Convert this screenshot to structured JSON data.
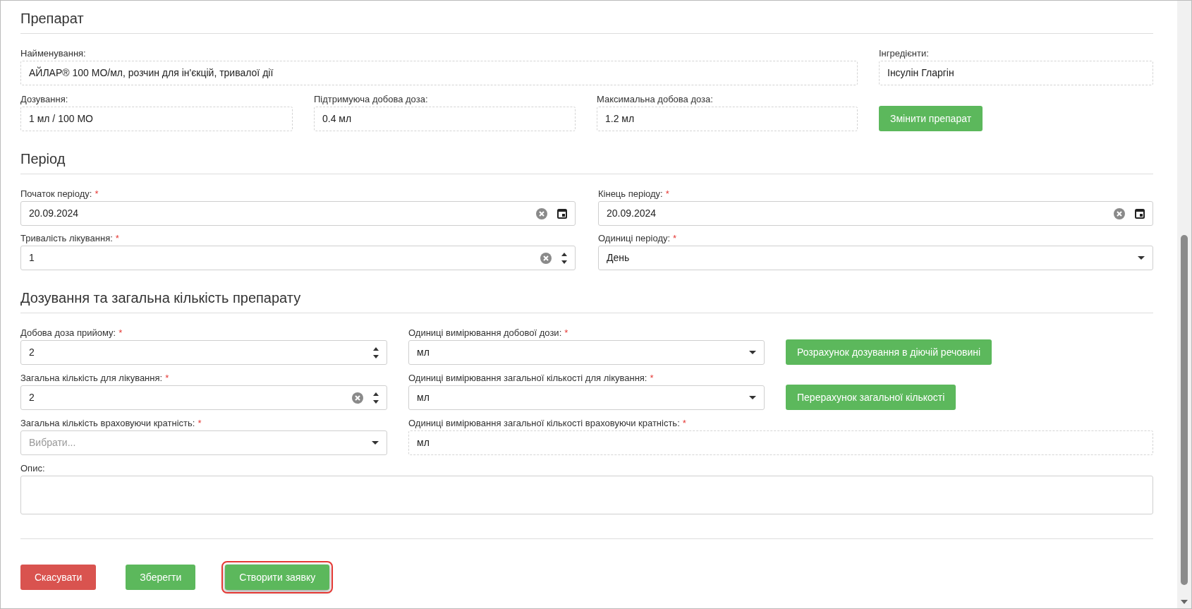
{
  "sections": [
    {
      "title": "Препарат",
      "fields": [
        {
          "label": "Найменування:",
          "kind": "readonly",
          "value": "АЙЛАР® 100 МО/мл, розчин для ін'єкцій, тривалої дії"
        },
        {
          "label": "Інгредієнти:",
          "kind": "readonly",
          "value": "Інсулін Гларгін"
        },
        {
          "label": "Дозування:",
          "kind": "readonly",
          "value": "1 мл / 100 МО"
        },
        {
          "label": "Підтримуюча добова доза:",
          "kind": "readonly",
          "value": "0.4 мл"
        },
        {
          "label": "Максимальна добова доза:",
          "kind": "readonly",
          "value": "1.2 мл"
        },
        {
          "kind": "button",
          "label": "Змінити препарат"
        }
      ]
    },
    {
      "title": "Період",
      "fields": [
        {
          "label": "Початок періоду:",
          "required_mark": "*",
          "kind": "date",
          "value": "20.09.2024",
          "clearable": true
        },
        {
          "label": "Кінець періоду:",
          "required_mark": "*",
          "kind": "date",
          "value": "20.09.2024",
          "clearable": true
        },
        {
          "label": "Тривалість лікування:",
          "required_mark": "*",
          "kind": "number",
          "value": "1",
          "clearable": true
        },
        {
          "label": "Одиниці періоду:",
          "required_mark": "*",
          "kind": "select",
          "value": "День"
        }
      ]
    },
    {
      "title": "Дозування та загальна кількість препарату",
      "fields": [
        {
          "label": "Добова доза прийому:",
          "required_mark": "*",
          "kind": "number",
          "value": "2",
          "clearable": false
        },
        {
          "label": "Одиниці вимірювання добової дози:",
          "required_mark": "*",
          "kind": "select",
          "value": "мл"
        },
        {
          "kind": "button",
          "label": "Розрахунок дозування в діючій речовині"
        },
        {
          "label": "Загальна кількість для лікування:",
          "required_mark": "*",
          "kind": "number",
          "value": "2",
          "clearable": true
        },
        {
          "label": "Одиниці вимірювання загальної кількості для лікування:",
          "required_mark": "*",
          "kind": "select",
          "value": "мл"
        },
        {
          "kind": "button",
          "label": "Перерахунок загальної кількості"
        },
        {
          "label": "Загальна кількість враховуючи кратність:",
          "required_mark": "*",
          "kind": "select",
          "placeholder": "Вибрати..."
        },
        {
          "label": "Одиниці вимірювання загальної кількості враховуючи кратність:",
          "required_mark": "*",
          "kind": "readonly",
          "value": "мл"
        },
        {
          "label": "Опис:",
          "kind": "textarea"
        }
      ]
    }
  ],
  "actions": [
    {
      "label": "Скасувати",
      "kind": "danger",
      "highlighted": false
    },
    {
      "label": "Зберегти",
      "kind": "success",
      "highlighted": false
    },
    {
      "label": "Створити заявку",
      "kind": "success",
      "highlighted": true
    }
  ]
}
